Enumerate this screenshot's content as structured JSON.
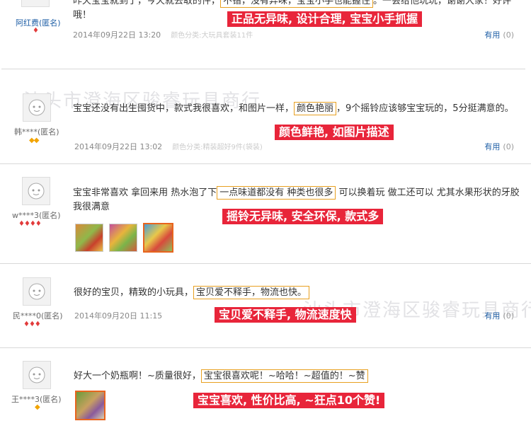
{
  "watermark": "汕头市澄海区骏睿玩具商行",
  "useful_label": "有用",
  "reviews": [
    {
      "user": "阿红费(匿名)",
      "text_pre": "昨天宝宝就到了，今天就去取的件，",
      "text_hl": "不错，没有异味，宝宝小手也能握住",
      "text_post": "。一会给他玩玩，谢谢大家！好评哦！",
      "date": "2014年09月22日 13:20",
      "sku": "颜色分类:大玩具套装11件",
      "useful_count": "(0)",
      "banner": "正品无异味, 设计合理, 宝宝小手抓握"
    },
    {
      "user": "韩****(匿名)",
      "rank": "◆◆",
      "text_pre": "宝宝还没有出生囤货中，款式我很喜欢，和图片一样，",
      "text_hl": "颜色艳丽",
      "text_post": "，9个摇铃应该够宝宝玩的，5分挺满意的。",
      "date": "2014年09月22日 13:02",
      "sku": "颜色分类:精装超好9件(袋装)",
      "useful_count": "(0)",
      "banner": "颜色鲜艳, 如图片描述"
    },
    {
      "user": "w****3(匿名)",
      "rank": "♦♦♦♦",
      "text_pre": "宝宝非常喜欢 拿回来用 热水泡了下",
      "text_hl": "一点味道都没有 种类也很多",
      "text_post": " 可以换着玩 做工还可以 尤其水果形状的牙胶 我很满意",
      "banner": "摇铃无异味, 安全环保, 款式多"
    },
    {
      "user": "民****0(匿名)",
      "rank": "♦♦♦",
      "text_pre": "很好的宝贝，精致的小玩具，",
      "text_hl": "宝贝爱不释手，物流也快。",
      "text_post": "",
      "date": "2014年09月20日 11:15",
      "useful_count": "(0)",
      "banner": "宝贝爱不释手, 物流速度快"
    },
    {
      "user": "王****3(匿名)",
      "rank": "◆",
      "text_pre": "好大一个奶瓶啊！~质量很好，",
      "text_hl": "宝宝很喜欢呢！~哈哈！~超值的！~赞",
      "text_post": "",
      "banner": "宝宝喜欢, 性价比高, ~狂点10个赞!"
    }
  ]
}
